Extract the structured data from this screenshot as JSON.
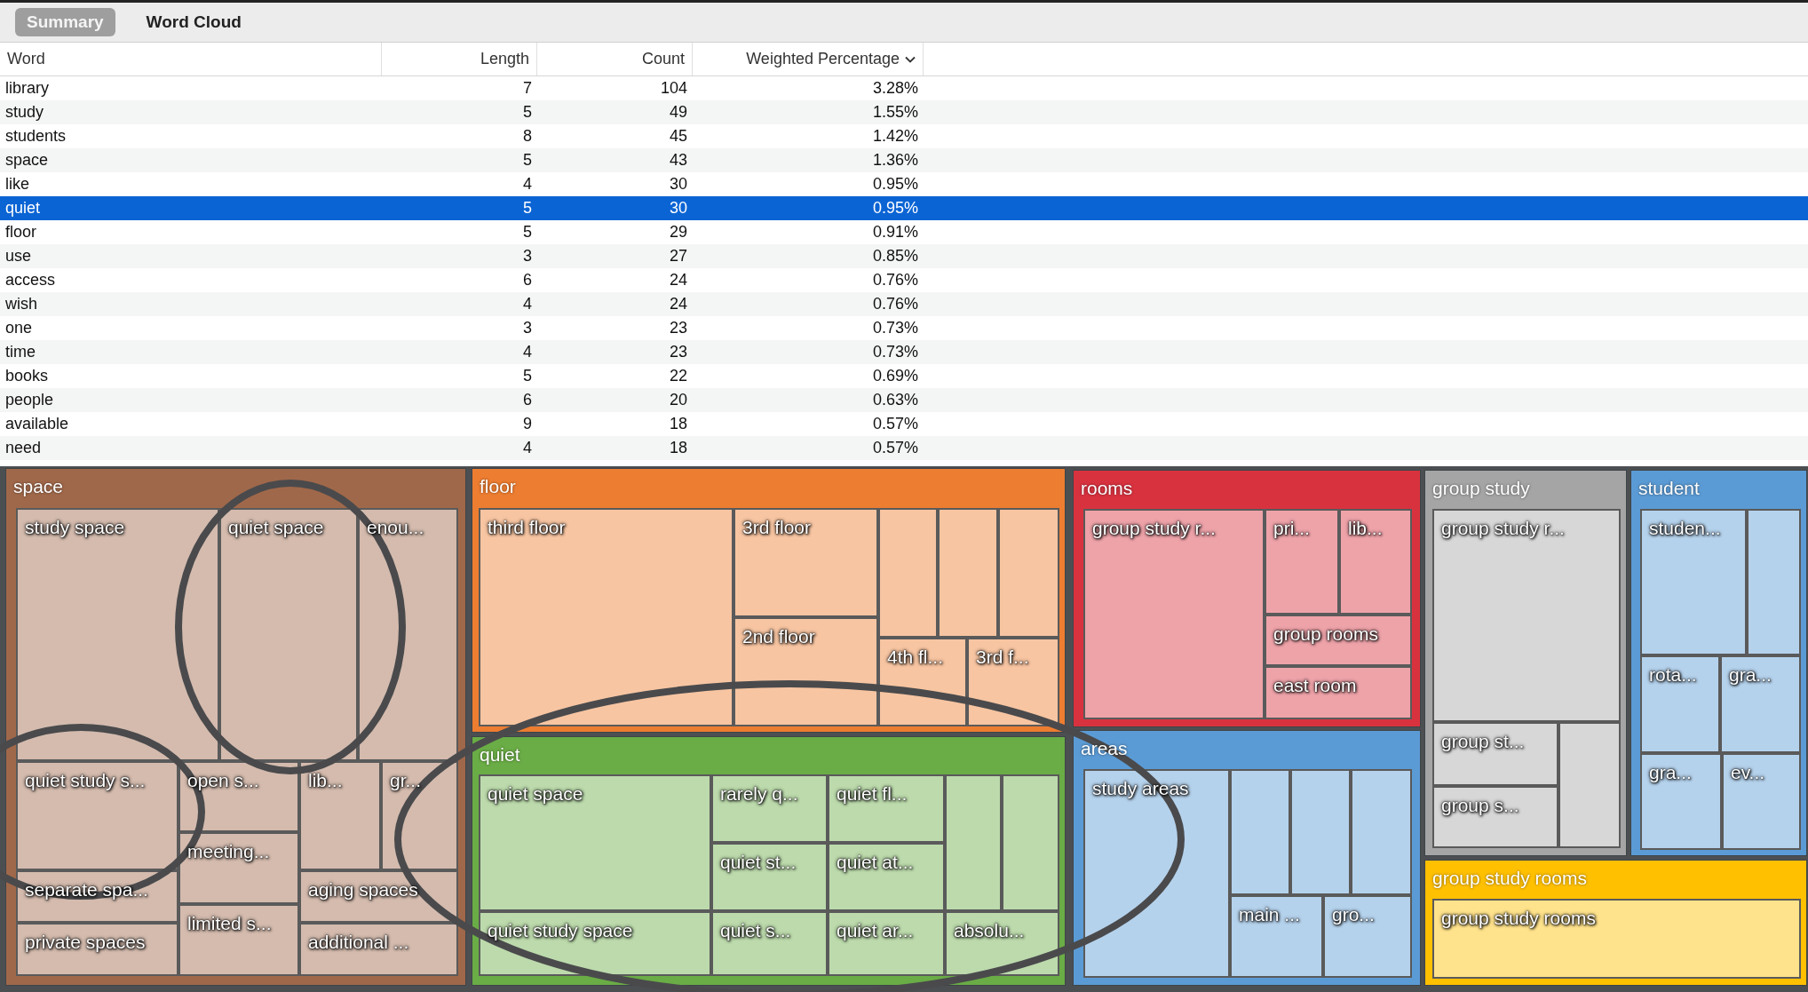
{
  "tabs": [
    {
      "label": "Summary",
      "selected": true
    },
    {
      "label": "Word Cloud",
      "selected": false
    }
  ],
  "table": {
    "columns": [
      {
        "label": "Word",
        "sorted": false
      },
      {
        "label": "Length",
        "sorted": false
      },
      {
        "label": "Count",
        "sorted": false
      },
      {
        "label": "Weighted Percentage",
        "sorted": true
      }
    ],
    "rows": [
      {
        "cells": [
          "library",
          "7",
          "104",
          "3.28%"
        ],
        "selected": false
      },
      {
        "cells": [
          "study",
          "5",
          "49",
          "1.55%"
        ],
        "selected": false
      },
      {
        "cells": [
          "students",
          "8",
          "45",
          "1.42%"
        ],
        "selected": false
      },
      {
        "cells": [
          "space",
          "5",
          "43",
          "1.36%"
        ],
        "selected": false
      },
      {
        "cells": [
          "like",
          "4",
          "30",
          "0.95%"
        ],
        "selected": false
      },
      {
        "cells": [
          "quiet",
          "5",
          "30",
          "0.95%"
        ],
        "selected": true
      },
      {
        "cells": [
          "floor",
          "5",
          "29",
          "0.91%"
        ],
        "selected": false
      },
      {
        "cells": [
          "use",
          "3",
          "27",
          "0.85%"
        ],
        "selected": false
      },
      {
        "cells": [
          "access",
          "6",
          "24",
          "0.76%"
        ],
        "selected": false
      },
      {
        "cells": [
          "wish",
          "4",
          "24",
          "0.76%"
        ],
        "selected": false
      },
      {
        "cells": [
          "one",
          "3",
          "23",
          "0.73%"
        ],
        "selected": false
      },
      {
        "cells": [
          "time",
          "4",
          "23",
          "0.73%"
        ],
        "selected": false
      },
      {
        "cells": [
          "books",
          "5",
          "22",
          "0.69%"
        ],
        "selected": false
      },
      {
        "cells": [
          "people",
          "6",
          "20",
          "0.63%"
        ],
        "selected": false
      },
      {
        "cells": [
          "available",
          "9",
          "18",
          "0.57%"
        ],
        "selected": false
      },
      {
        "cells": [
          "need",
          "4",
          "18",
          "0.57%"
        ],
        "selected": false
      }
    ]
  },
  "treemap": {
    "groups": [
      {
        "label": "space",
        "color": "#a0684a",
        "cells": [
          {
            "kind": "labeled",
            "label": "study space"
          },
          {
            "kind": "labeled",
            "label": "quiet space"
          },
          {
            "kind": "labeled",
            "label": "enou..."
          },
          {
            "kind": "labeled",
            "label": "quiet study s..."
          },
          {
            "kind": "labeled",
            "label": "separate spa..."
          },
          {
            "kind": "labeled",
            "label": "private spaces"
          },
          {
            "kind": "labeled",
            "label": "open s..."
          },
          {
            "kind": "labeled",
            "label": "meeting..."
          },
          {
            "kind": "labeled",
            "label": "limited s..."
          },
          {
            "kind": "labeled",
            "label": "lib..."
          },
          {
            "kind": "labeled",
            "label": "gr..."
          },
          {
            "kind": "labeled",
            "label": "aging spaces"
          },
          {
            "kind": "labeled",
            "label": "additional ..."
          }
        ]
      },
      {
        "label": "floor",
        "color": "#ed7d31",
        "cells": [
          {
            "kind": "labeled",
            "label": "third floor"
          },
          {
            "kind": "labeled",
            "label": "3rd floor"
          },
          {
            "kind": "labeled",
            "label": "2nd floor"
          },
          {
            "kind": "unlabeled"
          },
          {
            "kind": "unlabeled"
          },
          {
            "kind": "unlabeled"
          },
          {
            "kind": "labeled",
            "label": "4th fl..."
          },
          {
            "kind": "labeled",
            "label": "3rd f..."
          }
        ]
      },
      {
        "label": "quiet",
        "color": "#6aac46",
        "cells": [
          {
            "kind": "labeled",
            "label": "quiet space"
          },
          {
            "kind": "labeled",
            "label": "rarely q..."
          },
          {
            "kind": "labeled",
            "label": "quiet fl..."
          },
          {
            "kind": "unlabeled"
          },
          {
            "kind": "unlabeled"
          },
          {
            "kind": "labeled",
            "label": "quiet st..."
          },
          {
            "kind": "labeled",
            "label": "quiet at..."
          },
          {
            "kind": "labeled",
            "label": "quiet study space"
          },
          {
            "kind": "labeled",
            "label": "quiet s..."
          },
          {
            "kind": "labeled",
            "label": "quiet ar..."
          },
          {
            "kind": "labeled",
            "label": "absolu..."
          }
        ]
      },
      {
        "label": "rooms",
        "color": "#d9323f",
        "cells": [
          {
            "kind": "labeled",
            "label": "group study r..."
          },
          {
            "kind": "labeled",
            "label": "pri..."
          },
          {
            "kind": "labeled",
            "label": "lib..."
          },
          {
            "kind": "labeled",
            "label": "group rooms"
          },
          {
            "kind": "labeled",
            "label": "east room"
          }
        ]
      },
      {
        "label": "areas",
        "color": "#5b9bd5",
        "cells": [
          {
            "kind": "labeled",
            "label": "study areas"
          },
          {
            "kind": "unlabeled"
          },
          {
            "kind": "unlabeled"
          },
          {
            "kind": "unlabeled"
          },
          {
            "kind": "labeled",
            "label": "main ..."
          },
          {
            "kind": "labeled",
            "label": "gro..."
          }
        ]
      },
      {
        "label": "group study",
        "color": "#a5a5a5",
        "cells": [
          {
            "kind": "labeled",
            "label": "group study r..."
          },
          {
            "kind": "labeled",
            "label": "group st..."
          },
          {
            "kind": "labeled",
            "label": "group s..."
          },
          {
            "kind": "unlabeled"
          }
        ]
      },
      {
        "label": "student",
        "color": "#5b9bd5",
        "cells": [
          {
            "kind": "labeled",
            "label": "studen..."
          },
          {
            "kind": "unlabeled"
          },
          {
            "kind": "labeled",
            "label": "rota..."
          },
          {
            "kind": "labeled",
            "label": "gra..."
          },
          {
            "kind": "labeled",
            "label": "gra..."
          },
          {
            "kind": "labeled",
            "label": "ev..."
          }
        ]
      },
      {
        "label": "group study rooms",
        "color": "#ffc000",
        "cells": [
          {
            "kind": "labeled",
            "label": "group study rooms"
          }
        ]
      }
    ]
  },
  "annotations": [
    {
      "kind": "ellipse"
    },
    {
      "kind": "ellipse"
    },
    {
      "kind": "ellipse"
    }
  ]
}
